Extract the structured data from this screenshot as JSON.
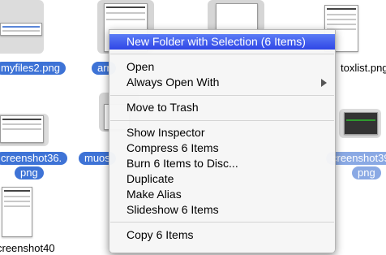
{
  "files": [
    {
      "name": "myfiles2.png"
    },
    {
      "name": "arr"
    },
    {
      "name": "toxlist.png"
    },
    {
      "name": "creenshot36."
    },
    {
      "name": "png"
    },
    {
      "name": "muos"
    },
    {
      "name": "creenshot39."
    },
    {
      "name": "png"
    },
    {
      "name": "creenshot40"
    }
  ],
  "menu": {
    "highlighted": "New Folder with Selection (6 Items)",
    "items": [
      "Open",
      "Always Open With",
      "Move to Trash",
      "Show Inspector",
      "Compress 6 Items",
      "Burn 6 Items to Disc...",
      "Duplicate",
      "Make Alias",
      "Slideshow 6 Items",
      "Copy 6 Items"
    ]
  },
  "colors": {
    "selection": "#3e73d6",
    "menu_highlight": "#2f46e6"
  }
}
